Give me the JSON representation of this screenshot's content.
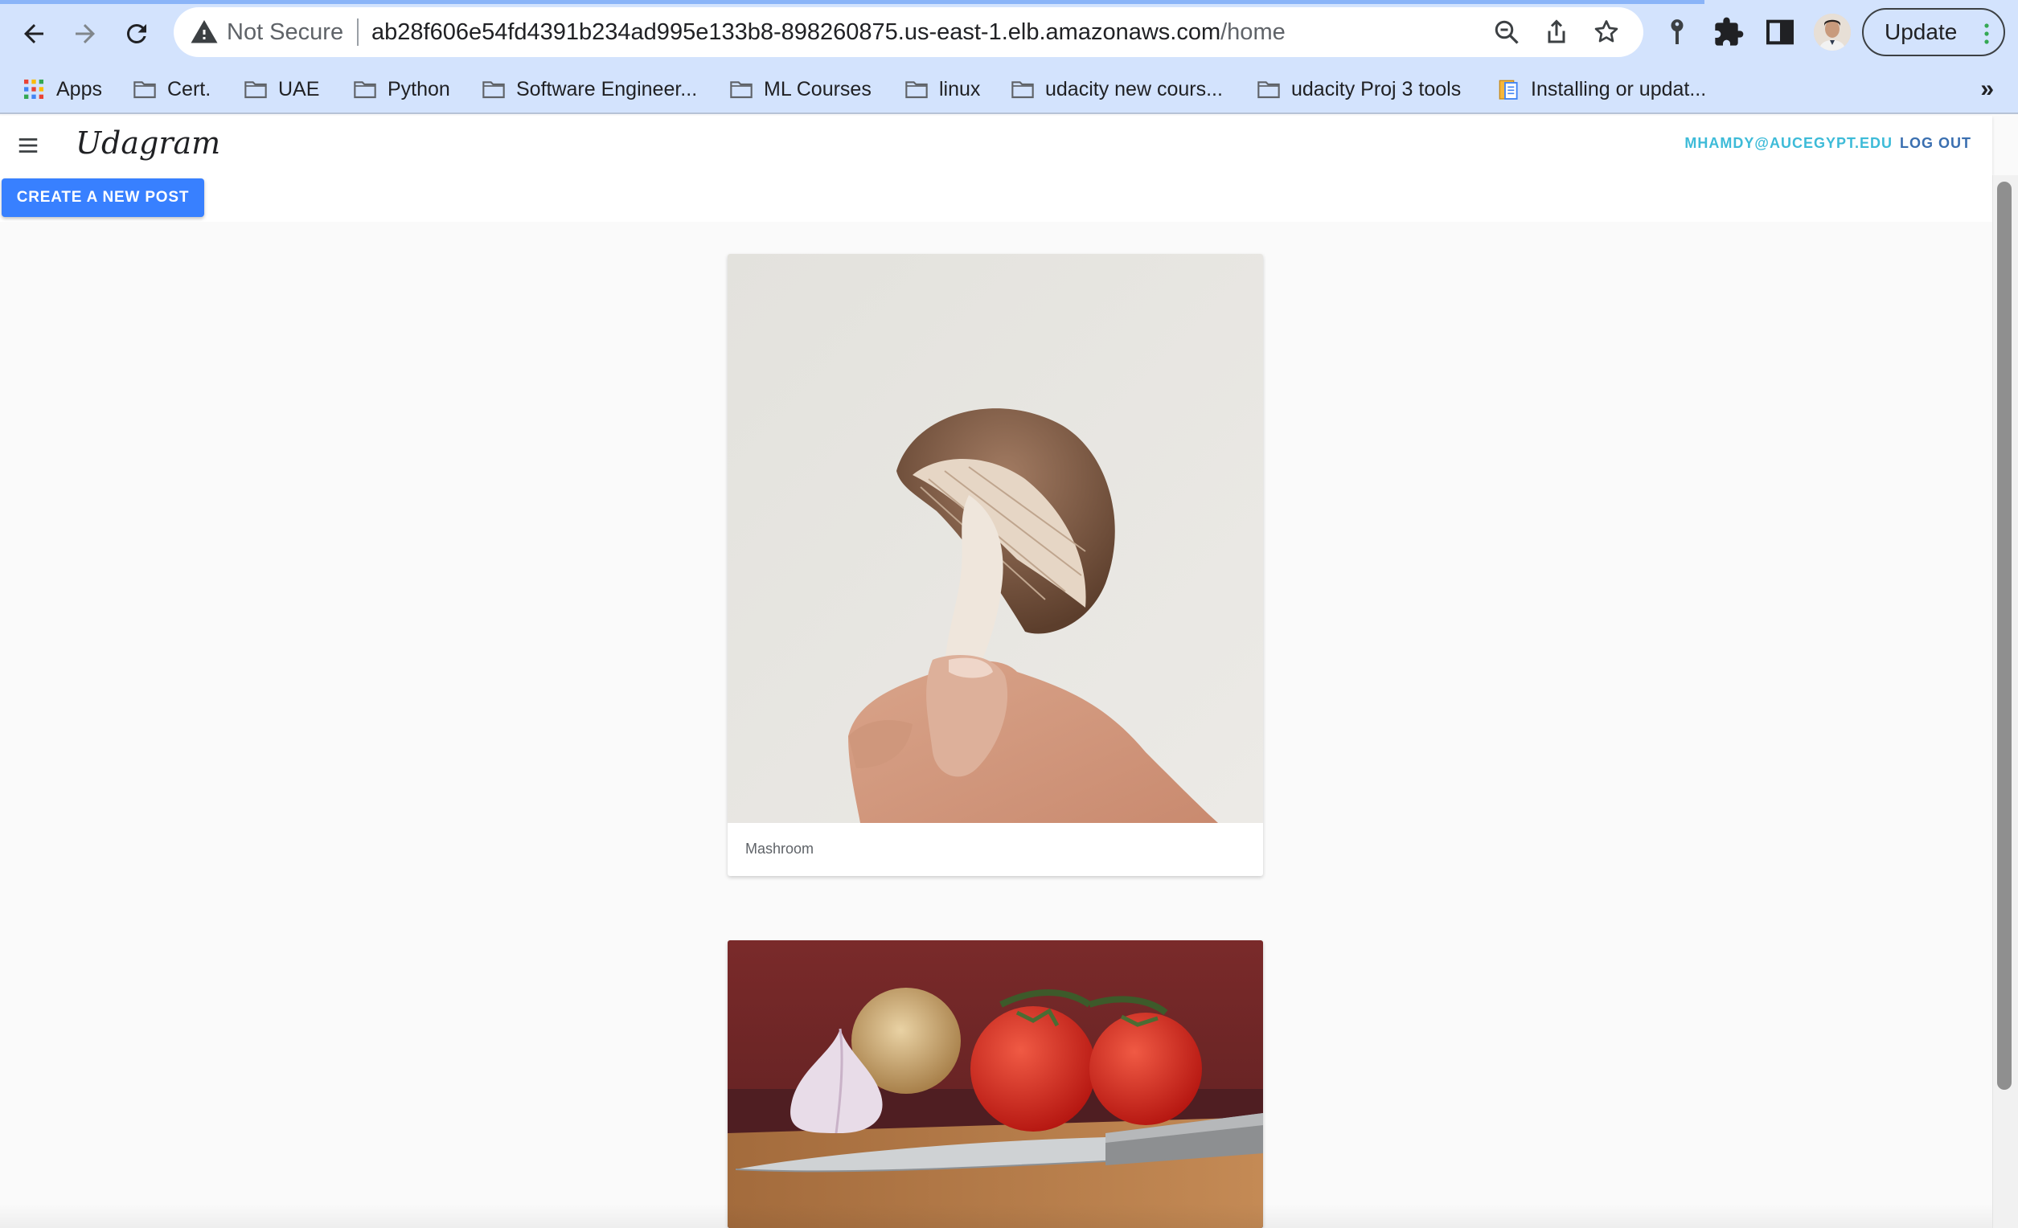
{
  "browser": {
    "security_label": "Not Secure",
    "url_host": "ab28f606e54fd4391b234ad995e133b8-898260875.us-east-1.elb.amazonaws.com",
    "url_path": "/home",
    "update_label": "Update",
    "toolbar_icons": [
      "back-icon",
      "forward-icon",
      "reload-icon",
      "zoom-icon",
      "share-icon",
      "star-icon",
      "key-icon",
      "extensions-icon",
      "side-panel-icon",
      "avatar"
    ]
  },
  "bookmarks": [
    {
      "label": "Apps",
      "icon": "apps-grid-icon"
    },
    {
      "label": "Cert.",
      "icon": "folder-icon"
    },
    {
      "label": "UAE",
      "icon": "folder-icon"
    },
    {
      "label": "Python",
      "icon": "folder-icon"
    },
    {
      "label": "Software Engineer...",
      "icon": "folder-icon"
    },
    {
      "label": "ML Courses",
      "icon": "folder-icon"
    },
    {
      "label": "linux",
      "icon": "folder-icon"
    },
    {
      "label": "udacity new cours...",
      "icon": "folder-icon"
    },
    {
      "label": "udacity Proj 3 tools",
      "icon": "folder-icon"
    },
    {
      "label": "Installing or updat...",
      "icon": "page-icon"
    }
  ],
  "bookmarks_more": "»",
  "app": {
    "title": "Udagram",
    "user_email": "MHAMDY@AUCEGYPT.EDU",
    "logout_label": "LOG OUT",
    "create_post_label": "CREATE A NEW POST",
    "colors": {
      "primary": "#3880ff",
      "email": "#3dbbd8",
      "logout": "#3a6fb0"
    }
  },
  "feed": [
    {
      "caption": "Mashroom",
      "image": "mushroom-in-hand-photo"
    },
    {
      "caption": "",
      "image": "tomatoes-garlic-onion-knife-photo"
    }
  ]
}
